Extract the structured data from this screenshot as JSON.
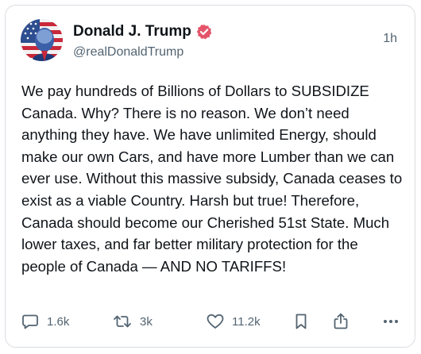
{
  "author": {
    "display_name": "Donald J. Trump",
    "handle": "@realDonaldTrump",
    "verified": true,
    "verified_color": "#e4556a",
    "avatar": "avatar-photo-flag-background"
  },
  "post": {
    "timestamp": "1h",
    "text": "We pay hundreds of Billions of Dollars to SUBSIDIZE Canada. Why? There is no reason. We don’t need anything they have. We have unlimited Energy, should make our own Cars, and have more Lumber than we can ever use. Without this massive subsidy, Canada ceases to exist as a viable Country. Harsh but true! Therefore, Canada should become our Cherished 51st State. Much lower taxes, and far better military protection for the people of Canada — AND NO TARIFFS!"
  },
  "actions": {
    "replies": "1.6k",
    "reposts": "3k",
    "likes": "11.2k",
    "icons": [
      "reply-icon",
      "repost-icon",
      "like-icon",
      "bookmark-icon",
      "share-icon",
      "more-icon"
    ]
  },
  "colors": {
    "text": "#0f1419",
    "muted": "#536471",
    "border": "#d9dde1"
  }
}
